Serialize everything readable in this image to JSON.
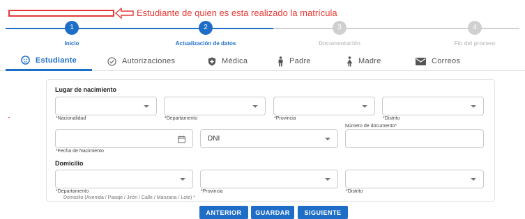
{
  "annotation": {
    "text": "Estudiante de quien es esta realizado la matrícula"
  },
  "stepper": {
    "steps": [
      {
        "number": "1",
        "label": "Inicio"
      },
      {
        "number": "2",
        "label": "Actualización de datos"
      },
      {
        "number": "3",
        "label": "Documentación"
      },
      {
        "number": "4",
        "label": "Fin del proceso"
      }
    ]
  },
  "tabs": [
    {
      "label": "Estudiante",
      "icon": "face-icon"
    },
    {
      "label": "Autorizaciones",
      "icon": "check-circle-icon"
    },
    {
      "label": "Médica",
      "icon": "shield-icon"
    },
    {
      "label": "Padre",
      "icon": "man-icon"
    },
    {
      "label": "Madre",
      "icon": "woman-icon"
    },
    {
      "label": "Correos",
      "icon": "mail-icon"
    }
  ],
  "form": {
    "birthplace_title": "Lugar de nacimiento",
    "nacionalidad_label": "*Nacionalidad",
    "departamento_label": "*Departamento",
    "provincia_label": "*Provincia",
    "distrito_label": "*Distrito",
    "fecha_label": "*Fecha de Nacimiento",
    "doc_type_value": "DNI",
    "doc_number_label": "Número de documento*",
    "domicilio_title": "Domicilio",
    "dom_departamento_label": "*Departamento",
    "dom_provincia_label": "*Provincia",
    "dom_distrito_label": "*Distrito",
    "address_hint": "Domicilio (Avenida / Pasaje / Jirón / Calle / Manzana / Lote) *"
  },
  "buttons": {
    "prev": "ANTERIOR",
    "save": "GUARDAR",
    "next": "SIGUIENTE"
  },
  "colors": {
    "primary": "#1e6ec8",
    "inactive": "#d0d0d0",
    "annotation": "#e53935"
  }
}
